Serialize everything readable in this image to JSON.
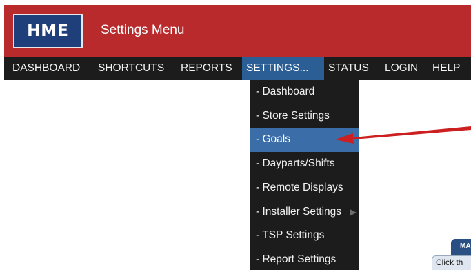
{
  "header": {
    "logo_text": "HME",
    "title": "Settings Menu",
    "background_color": "#b82a2c"
  },
  "nav": {
    "items": [
      {
        "label": "DASHBOARD"
      },
      {
        "label": "SHORTCUTS"
      },
      {
        "label": "REPORTS"
      },
      {
        "label": "SETTINGS..."
      },
      {
        "label": "STATUS"
      },
      {
        "label": "LOGIN"
      },
      {
        "label": "HELP"
      }
    ],
    "active_index": 3,
    "active_color": "#2b5e95"
  },
  "settings_menu": {
    "items": [
      {
        "label": "- Dashboard"
      },
      {
        "label": "- Store Settings"
      },
      {
        "label": "- Goals"
      },
      {
        "label": "- Dayparts/Shifts"
      },
      {
        "label": "- Remote Displays"
      },
      {
        "label": "- Installer Settings",
        "has_submenu": true,
        "submenu_icon": "chevron-right-icon"
      },
      {
        "label": "- TSP Settings"
      },
      {
        "label": "- Report Settings"
      }
    ],
    "selected_index": 2,
    "selected_color": "#3b6ea8"
  },
  "annotation": {
    "arrow_color": "#cc1f1f"
  },
  "corner_widget": {
    "tab_label": "MA",
    "panel_text": "Click th"
  }
}
